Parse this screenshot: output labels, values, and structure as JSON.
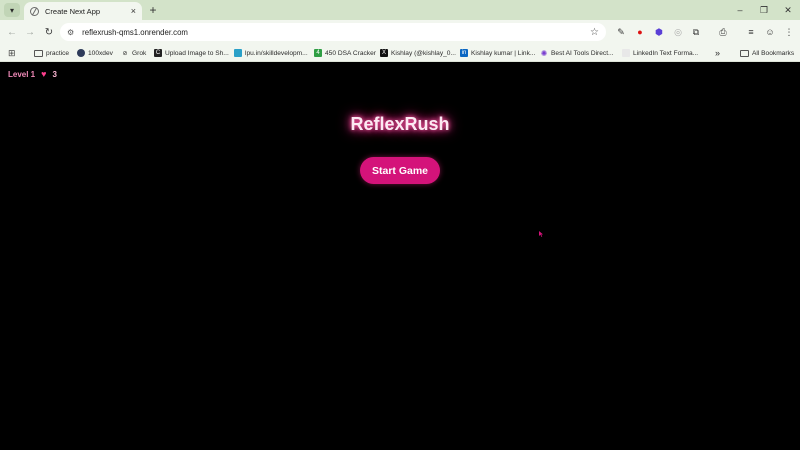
{
  "browser": {
    "tab_title": "Create Next App",
    "tab_close_glyph": "×",
    "new_tab_glyph": "+",
    "url": "reflexrush-qms1.onrender.com",
    "window_controls": [
      "–",
      "❐",
      "✕"
    ],
    "bookmarks": [
      {
        "label": "practice",
        "icon": "folder-icon"
      },
      {
        "label": "100xdev",
        "icon": "globe-icon"
      },
      {
        "label": "Grok",
        "icon": "grok-icon"
      },
      {
        "label": "Upload Image to Sh...",
        "icon": "c-icon"
      },
      {
        "label": "lpu.in/skilldevelopm...",
        "icon": "monitor-icon"
      },
      {
        "label": "450 DSA Cracker",
        "icon": "sheet-icon"
      },
      {
        "label": "Kishlay (@kishlay_0...",
        "icon": "x-icon"
      },
      {
        "label": "Kishlay kumar | Link...",
        "icon": "linkedin-icon"
      },
      {
        "label": "Best AI Tools Direct...",
        "icon": "gear-icon"
      },
      {
        "label": "LinkedIn Text Forma...",
        "icon": "doc-icon"
      }
    ],
    "overflow_glyph": "»",
    "all_bookmarks": "All Bookmarks"
  },
  "game": {
    "level": "Level 1",
    "lives": "3",
    "title": "ReflexRush",
    "start_button": "Start Game"
  },
  "colors": {
    "background": "#000000",
    "accent": "#d4137a",
    "hud_text": "#f08ab8",
    "heart": "#ff3f8e"
  }
}
